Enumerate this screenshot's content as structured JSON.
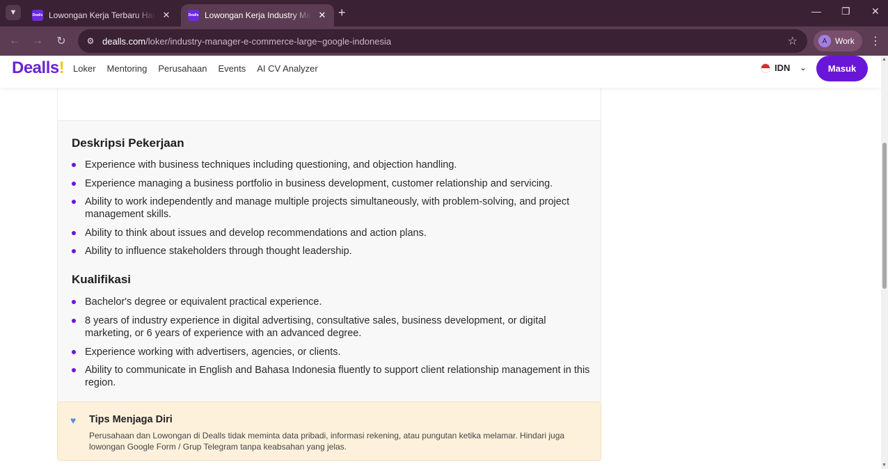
{
  "browser": {
    "tabs": [
      {
        "title": "Lowongan Kerja Terbaru Hari Ini",
        "favicon": "Dealls",
        "active": false
      },
      {
        "title": "Lowongan Kerja Industry Manager",
        "favicon": "Dealls",
        "active": true
      }
    ],
    "url_host": "dealls.com",
    "url_path": "/loker/industry-manager-e-commerce-large~google-indonesia",
    "profile_initial": "A",
    "profile_label": "Work"
  },
  "site": {
    "logo": "Dealls",
    "logo_mark": "!",
    "nav": [
      "Loker",
      "Mentoring",
      "Perusahaan",
      "Events",
      "AI CV Analyzer"
    ],
    "language": "IDN",
    "login_label": "Masuk",
    "brand_color": "#6a16d8"
  },
  "job": {
    "description_title": "Deskripsi Pekerjaan",
    "description_items": [
      "Experience with business techniques including questioning, and objection handling.",
      "Experience managing a business portfolio in business development, customer relationship and servicing.",
      "Ability to work independently and manage multiple projects simultaneously, with problem-solving, and project management skills.",
      "Ability to think about issues and develop recommendations and action plans.",
      "Ability to influence stakeholders through thought leadership."
    ],
    "qualification_title": "Kualifikasi",
    "qualification_items": [
      "Bachelor's degree or equivalent practical experience.",
      "8 years of industry experience in digital advertising, consultative sales, business development, or digital marketing, or 6 years of experience with an advanced degree.",
      "Experience working with advertisers, agencies, or clients.",
      "Ability to communicate in English and Bahasa Indonesia fluently to support client relationship management in this region."
    ]
  },
  "tips": {
    "icon": "blue-heart-icon",
    "title": "Tips Menjaga Diri",
    "body": "Perusahaan dan Lowongan di Dealls tidak meminta data pribadi, informasi rekening, atau pungutan ketika melamar. Hindari juga lowongan Google Form / Grup Telegram tanpa keabsahan yang jelas."
  }
}
